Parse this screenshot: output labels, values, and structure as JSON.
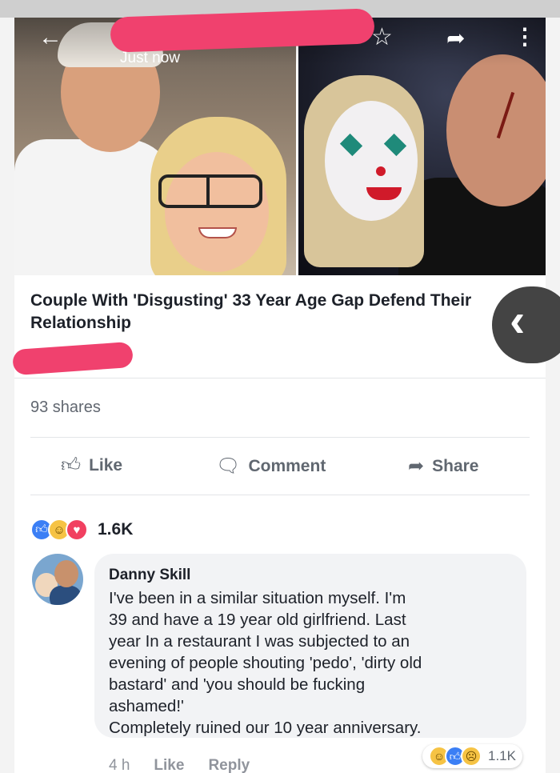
{
  "post": {
    "timestamp": "Just now",
    "headline": "Couple With 'Disgusting' 33 Year Age Gap Defend Their Relationship",
    "shares": "93 shares"
  },
  "icons": {
    "back": "←",
    "star": "☆",
    "share": "➦",
    "more": "⋮",
    "close_back": "‹"
  },
  "actions": {
    "like": "Like",
    "comment": "Comment",
    "share": "Share"
  },
  "reactions": {
    "count": "1.6K"
  },
  "comment": {
    "author": "Danny Skill",
    "text": "I've been in a similar situation  myself. I'm\n39 and have a 19 year old girlfriend. Last\nyear In a restaurant I was subjected to an\nevening of people shouting 'pedo', 'dirty old\nbastard' and 'you should be fucking\nashamed!'\nCompletely ruined our 10 year anniversary.",
    "time": "4 h",
    "like_label": "Like",
    "reply_label": "Reply",
    "reaction_count": "1.1K"
  },
  "colors": {
    "redaction": "#f0416e",
    "like_blue": "#3b7ff5",
    "love_red": "#f14060",
    "haha_yellow": "#f6c344"
  }
}
